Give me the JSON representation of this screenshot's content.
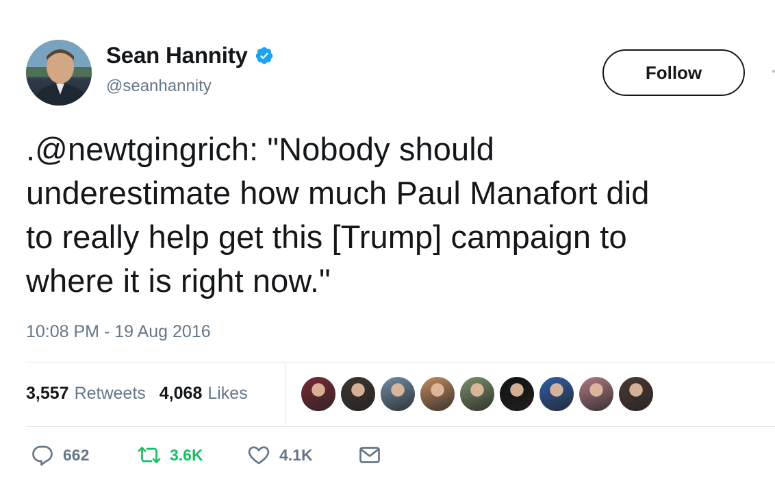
{
  "author": {
    "display_name": "Sean Hannity",
    "handle": "@seanhannity",
    "verified": true
  },
  "follow_button": {
    "label": "Follow"
  },
  "tweet": {
    "text": ".@newtgingrich: \"Nobody should\nunderestimate how much Paul Manafort did\nto really help get this [Trump] campaign to\nwhere it is right now.\"",
    "timestamp": "10:08 PM - 19 Aug 2016"
  },
  "stats": {
    "retweets_count": "3,557",
    "retweets_label": "Retweets",
    "likes_count": "4,068",
    "likes_label": "Likes"
  },
  "liker_avatars": [
    {
      "icon": "flag-portrait-avatar",
      "color": "#7a2a35"
    },
    {
      "icon": "bearded-man-avatar",
      "color": "#3b3530"
    },
    {
      "icon": "logo-avatar",
      "color": "#6f8da6"
    },
    {
      "icon": "woman-avatar",
      "color": "#c38a5f"
    },
    {
      "icon": "outdoor-avatar",
      "color": "#7b8f6a"
    },
    {
      "icon": "lightning-logo-avatar",
      "color": "#111111"
    },
    {
      "icon": "cartoon-avatar",
      "color": "#2f5fa8"
    },
    {
      "icon": "collage-avatar",
      "color": "#b07a84"
    },
    {
      "icon": "glasses-man-avatar",
      "color": "#4a3a33"
    }
  ],
  "actions": {
    "reply_count": "662",
    "retweet_count": "3.6K",
    "like_count": "4.1K"
  },
  "colors": {
    "text": "#14171a",
    "secondary": "#657786",
    "verified": "#1da1f2",
    "retweet_green": "#17bf63",
    "divider": "#e1e8ed"
  }
}
